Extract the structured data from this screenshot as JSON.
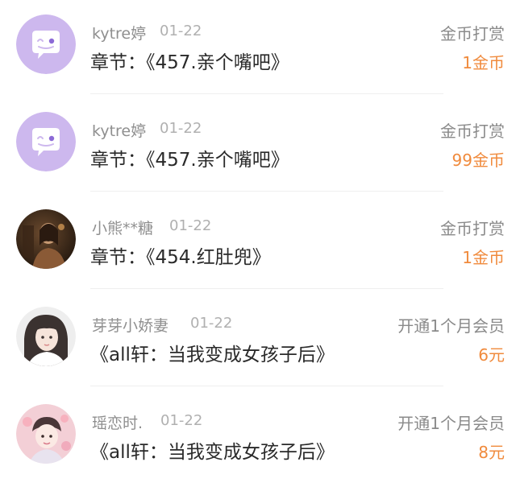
{
  "records": [
    {
      "avatar": "chat-bubble-avatar",
      "username": "kytre婷",
      "date": "01-22",
      "content": "章节：《457.亲个嘴吧》",
      "gift_type": "金币打赏",
      "amount": "1金币"
    },
    {
      "avatar": "chat-bubble-avatar",
      "username": "kytre婷",
      "date": "01-22",
      "content": "章节：《457.亲个嘴吧》",
      "gift_type": "金币打赏",
      "amount": "99金币"
    },
    {
      "avatar": "photo-avatar",
      "username": "小熊**糖",
      "date": "01-22",
      "content": "章节：《454.红肚兜》",
      "gift_type": "金币打赏",
      "amount": "1金币"
    },
    {
      "avatar": "photo-avatar",
      "username": "芽芽小娇妻",
      "date": "01-22",
      "content": "《all轩：当我变成女孩子后》",
      "gift_type": "开通1个月会员",
      "amount": "6元"
    },
    {
      "avatar": "photo-avatar",
      "username": "瑶恋时.",
      "date": "01-22",
      "content": "《all轩：当我变成女孩子后》",
      "gift_type": "开通1个月会员",
      "amount": "8元"
    }
  ],
  "colors": {
    "accent": "#f08a3c",
    "avatar_purple": "#cdb8ee",
    "username": "#8f8f8f",
    "content": "#2a2a2a"
  }
}
